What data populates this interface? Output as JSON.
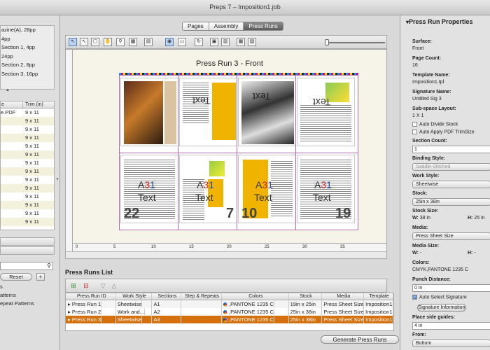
{
  "window": {
    "title": "Preps 7 – Imposition1.job"
  },
  "tabs": [
    {
      "label": "Pages"
    },
    {
      "label": "Assembly"
    },
    {
      "label": "Press Runs"
    }
  ],
  "left": {
    "sections": [
      "azine(A), 28pp",
      "4pp",
      "Section 1, 4pp",
      "24pp",
      "Section 2, 8pp",
      "Section 3, 16pp"
    ],
    "files_header": {
      "name": "e",
      "trim": "Trim (in)"
    },
    "files": [
      {
        "name": "e.PDF",
        "trim": "9 x 11"
      },
      {
        "name": "",
        "trim": "9 x 11"
      },
      {
        "name": "",
        "trim": "9 x 11"
      },
      {
        "name": "",
        "trim": "9 x 11"
      },
      {
        "name": "",
        "trim": "9 x 11"
      },
      {
        "name": "",
        "trim": "9 x 11"
      },
      {
        "name": "",
        "trim": "9 x 11"
      },
      {
        "name": "",
        "trim": "9 x 11"
      },
      {
        "name": "",
        "trim": "9 x 11"
      },
      {
        "name": "",
        "trim": "9 x 11"
      },
      {
        "name": "",
        "trim": "9 x 11"
      },
      {
        "name": "",
        "trim": "9 x 11"
      },
      {
        "name": "",
        "trim": "9 x 11"
      },
      {
        "name": "",
        "trim": "9 x 11"
      }
    ],
    "reset_label": "Reset",
    "plus_label": "+",
    "patterns": [
      "s",
      "atterns",
      "epeat Patterns"
    ]
  },
  "canvas": {
    "sheet_title": "Press Run 3 - Front",
    "overlay_text": "Text",
    "overlay_marks": [
      "A",
      "3",
      "1"
    ],
    "page_numbers": [
      "22",
      "7",
      "10",
      "19"
    ],
    "ruler_labels": [
      "0",
      "5",
      "10",
      "15",
      "20",
      "25",
      "30",
      "35"
    ]
  },
  "press_runs": {
    "title": "Press Runs List",
    "columns": [
      "Press Run ID",
      "Work Style",
      "Sections",
      "Step & Repeats",
      "Colors",
      "Stock",
      "Media",
      "Template"
    ],
    "rows": [
      {
        "id": "Press Run 1",
        "work_style": "Sheetwise",
        "sections": "A1",
        "step": "",
        "colors": ",PANTONE 1235 C",
        "stock": "19in x 25in",
        "media": "Press Sheet Size",
        "template": "Imposition1.tpl",
        "selected": false
      },
      {
        "id": "Press Run 2",
        "work_style": "Work and...",
        "sections": "A2",
        "step": "",
        "colors": ",PANTONE 1235 C",
        "stock": "25in x 38in",
        "media": "Press Sheet Size",
        "template": "Imposition1.tpl",
        "selected": false
      },
      {
        "id": "Press Run 3",
        "work_style": "Sheetwise",
        "sections": "A3",
        "step": "",
        "colors": ",PANTONE 1235 C",
        "stock": "25in x 38in",
        "media": "Press Sheet Size",
        "template": "Imposition1.tpl",
        "selected": true
      }
    ],
    "generate_label": "Generate Press Runs"
  },
  "properties": {
    "title": "Press Run Properties",
    "surface_label": "Surface:",
    "surface": "Front",
    "page_count_label": "Page Count:",
    "page_count": "16",
    "template_label": "Template Name:",
    "template": "Imposition1.tpl",
    "signature_label": "Signature Name:",
    "signature": "Untitled Sig 3",
    "subspace_label": "Sub-space Layout:",
    "subspace": "1 X 1",
    "auto_divide": "Auto Divide Stock",
    "auto_apply": "Auto Apply PDF TrimSize",
    "section_count_label": "Section Count:",
    "section_count": "1",
    "binding_label": "Binding Style:",
    "binding": "Saddle-Stitched",
    "work_style_label": "Work Style:",
    "work_style": "Sheetwise",
    "stock_label": "Stock:",
    "stock": "25in x 38in",
    "stock_size_label": "Stock Size:",
    "stock_w_label": "W:",
    "stock_w": "38 in",
    "stock_h_label": "H:",
    "stock_h": "25 in",
    "media_label": "Media:",
    "media": "Press Sheet Size",
    "media_size_label": "Media Size:",
    "media_w_label": "W:",
    "media_w": "-",
    "media_h_label": "H:",
    "media_h": "-",
    "colors_label": "Colors:",
    "colors": "CMYK,PANTONE 1235 C",
    "punch_label": "Punch Distance:",
    "punch": "0 in",
    "auto_select": "Auto Select Signature",
    "sig_info_btn": "Signature Information",
    "side_guides_label": "Place side guides:",
    "side_guides": "4 in",
    "from_label": "From:",
    "from": "Bottom"
  },
  "colors": {
    "selection": "#d5700f",
    "fold": "#b06bb3",
    "tab_active": "#6a6a6a"
  }
}
